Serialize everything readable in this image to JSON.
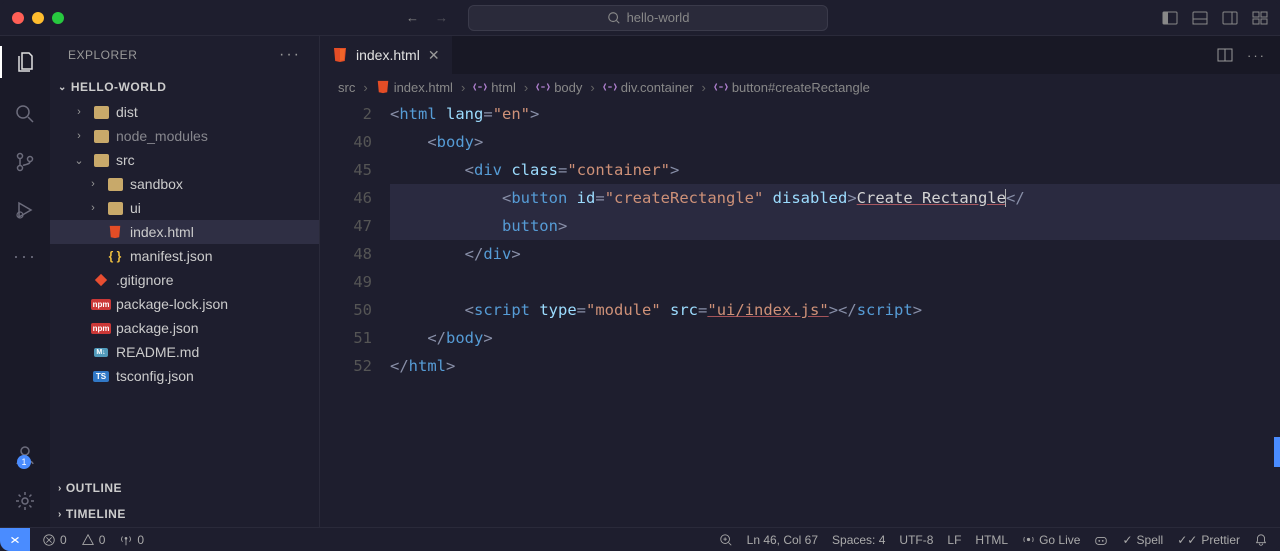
{
  "titlebar": {
    "search": "hello-world"
  },
  "sidebar": {
    "title": "EXPLORER",
    "folder": "HELLO-WORLD",
    "tree": [
      {
        "name": "dist",
        "type": "folder",
        "indent": 1,
        "collapsed": true
      },
      {
        "name": "node_modules",
        "type": "folder-dim",
        "indent": 1,
        "collapsed": true
      },
      {
        "name": "src",
        "type": "folder",
        "indent": 1,
        "collapsed": false
      },
      {
        "name": "sandbox",
        "type": "folder",
        "indent": 2,
        "collapsed": true
      },
      {
        "name": "ui",
        "type": "folder",
        "indent": 2,
        "collapsed": true
      },
      {
        "name": "index.html",
        "type": "html",
        "indent": 2,
        "selected": true
      },
      {
        "name": "manifest.json",
        "type": "json",
        "indent": 2
      },
      {
        "name": ".gitignore",
        "type": "git",
        "indent": 1
      },
      {
        "name": "package-lock.json",
        "type": "npm",
        "indent": 1
      },
      {
        "name": "package.json",
        "type": "npm",
        "indent": 1
      },
      {
        "name": "README.md",
        "type": "md",
        "indent": 1
      },
      {
        "name": "tsconfig.json",
        "type": "ts",
        "indent": 1
      }
    ],
    "outline": "OUTLINE",
    "timeline": "TIMELINE"
  },
  "accounts_badge": "1",
  "tab": {
    "label": "index.html"
  },
  "breadcrumb": [
    "src",
    "index.html",
    "html",
    "body",
    "div.container",
    "button#createRectangle"
  ],
  "code": {
    "line_numbers": [
      "2",
      "40",
      "45",
      "46",
      "",
      "47",
      "48",
      "49",
      "50",
      "51",
      "52"
    ],
    "lines": {
      "l2": {
        "tag": "html",
        "attr": "lang",
        "val": "\"en\""
      },
      "l40": {
        "tag": "body"
      },
      "l45": {
        "tag": "div",
        "attr": "class",
        "val": "\"container\""
      },
      "l46a": {
        "tag": "button",
        "attr1": "id",
        "val1": "\"createRectangle\"",
        "attr2": "disabled",
        "text": "Create Rectangle"
      },
      "l46b": {
        "close": "button"
      },
      "l47": {
        "close": "div"
      },
      "l49": {
        "tag": "script",
        "attr1": "type",
        "val1": "\"module\"",
        "attr2": "src",
        "val2": "\"ui/index.js\"",
        "close": "script"
      },
      "l50": {
        "close": "body"
      },
      "l51": {
        "close": "html"
      }
    }
  },
  "status": {
    "errors": "0",
    "warnings": "0",
    "ports": "0",
    "ln_col": "Ln 46, Col 67",
    "spaces": "Spaces: 4",
    "encoding": "UTF-8",
    "eol": "LF",
    "lang": "HTML",
    "golive": "Go Live",
    "spell": "Spell",
    "prettier": "Prettier"
  }
}
